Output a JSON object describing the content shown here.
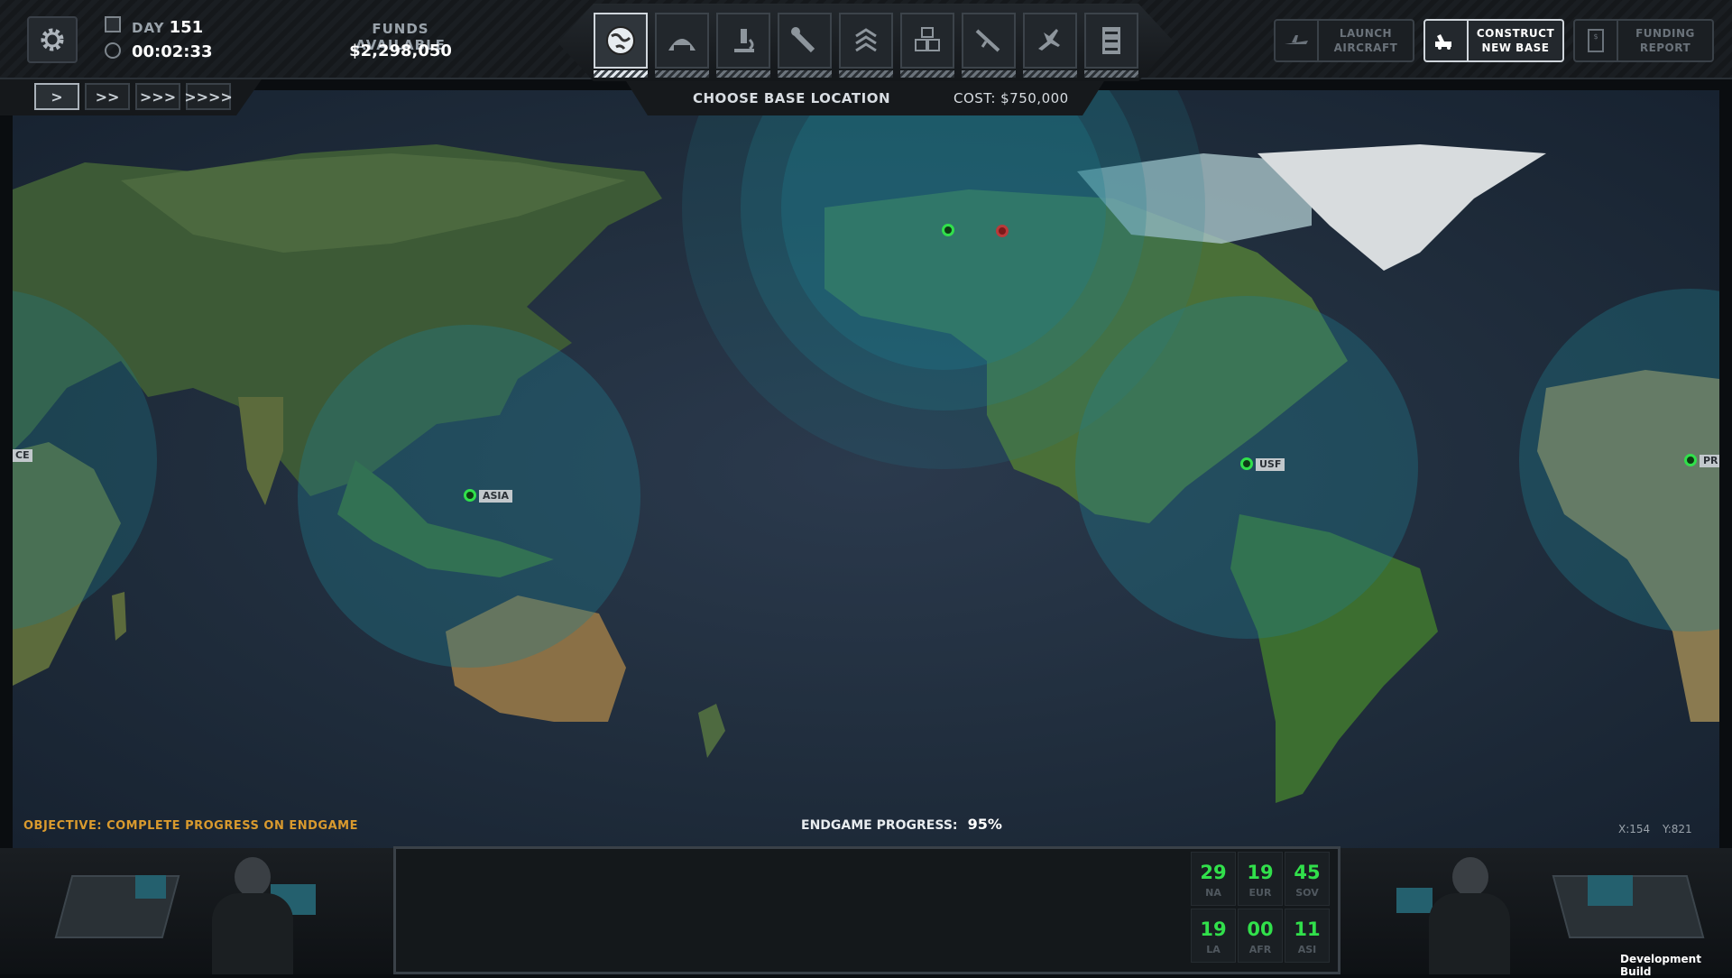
{
  "header": {
    "day_label": "DAY",
    "day_value": "151",
    "clock": "00:02:33",
    "funds_label": "FUNDS AVAILABLE",
    "funds_value": "$2,298,050"
  },
  "tabs": [
    {
      "icon": "globe-icon",
      "active": true
    },
    {
      "icon": "hangar-icon",
      "active": false
    },
    {
      "icon": "microscope-icon",
      "active": false
    },
    {
      "icon": "wrench-icon",
      "active": false
    },
    {
      "icon": "rank-chevron-icon",
      "active": false
    },
    {
      "icon": "storage-crates-icon",
      "active": false
    },
    {
      "icon": "rifle-icon",
      "active": false
    },
    {
      "icon": "jet-icon",
      "active": false
    },
    {
      "icon": "file-cabinet-icon",
      "active": false
    }
  ],
  "right_buttons": {
    "launch_line1": "LAUNCH",
    "launch_line2": "AIRCRAFT",
    "construct_line1": "CONSTRUCT",
    "construct_line2": "NEW BASE",
    "funding_line1": "FUNDING",
    "funding_line2": "REPORT"
  },
  "speed_buttons": [
    ">",
    ">>",
    ">>>",
    ">>>>"
  ],
  "choose_bar": {
    "title": "CHOOSE BASE LOCATION",
    "cost": "COST: $750,000"
  },
  "map": {
    "bases": [
      {
        "label": "ASIA"
      },
      {
        "label": "USF"
      },
      {
        "label": "PR"
      },
      {
        "label": "CE"
      }
    ]
  },
  "objective": "OBJECTIVE: COMPLETE PROGRESS ON ENDGAME",
  "endgame": {
    "label": "ENDGAME PROGRESS:",
    "value": "95%"
  },
  "cursor": {
    "x": "X:154",
    "y": "Y:821"
  },
  "regions": [
    {
      "num": "29",
      "name": "NA"
    },
    {
      "num": "19",
      "name": "EUR"
    },
    {
      "num": "45",
      "name": "SOV"
    },
    {
      "num": "19",
      "name": "LA"
    },
    {
      "num": "00",
      "name": "AFR"
    },
    {
      "num": "11",
      "name": "ASI"
    }
  ],
  "build_label": "Development Build",
  "colors": {
    "accent_green": "#31e04b",
    "objective_orange": "#d99a2e",
    "radar_cyan": "#1f7f8f"
  }
}
